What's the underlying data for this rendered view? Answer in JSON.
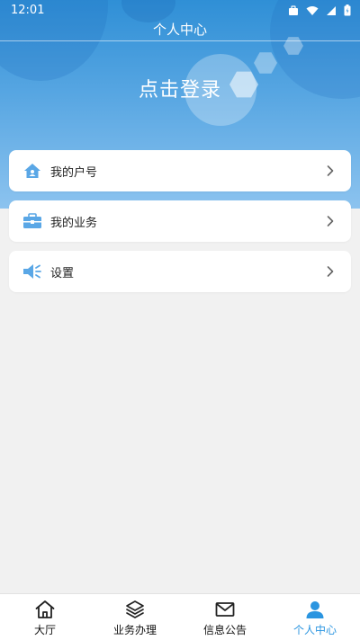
{
  "status_bar": {
    "time": "12:01"
  },
  "header": {
    "title": "个人中心",
    "login_text": "点击登录"
  },
  "menu": [
    {
      "label": "我的户号",
      "icon": "house-icon"
    },
    {
      "label": "我的业务",
      "icon": "briefcase-icon"
    },
    {
      "label": "设置",
      "icon": "speaker-icon"
    }
  ],
  "tabs": [
    {
      "label": "大厅",
      "icon": "home-icon",
      "active": false
    },
    {
      "label": "业务办理",
      "icon": "layers-icon",
      "active": false
    },
    {
      "label": "信息公告",
      "icon": "mail-icon",
      "active": false
    },
    {
      "label": "个人中心",
      "icon": "user-icon",
      "active": true
    }
  ],
  "colors": {
    "accent": "#2b95e0",
    "header_top": "#2f8fd6",
    "header_bottom": "#8cc3ef",
    "background": "#f1f1f1"
  }
}
